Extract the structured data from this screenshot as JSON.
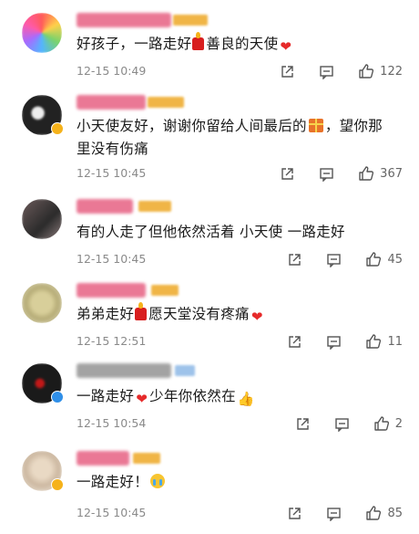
{
  "comments": [
    {
      "text": "好孩子，一路走好",
      "suffix": "善良的天使",
      "time": "12-15 10:49",
      "likes": "122"
    },
    {
      "text": "小天使友好，谢谢你留给人间最后的",
      "suffix": "，望你那",
      "text2": "里没有伤痛",
      "time": "12-15 10:45",
      "likes": "367"
    },
    {
      "text": "有的人走了但他依然活着 小天使 一路走好",
      "time": "12-15 10:45",
      "likes": "45"
    },
    {
      "text": "弟弟走好",
      "suffix": "愿天堂没有疼痛",
      "time": "12-15 12:51",
      "likes": "11"
    },
    {
      "text": "一路走好",
      "suffix": "少年你依然在",
      "time": "12-15 10:54",
      "likes": "2"
    },
    {
      "text": "一路走好！",
      "time": "12-15 10:45",
      "likes": "85"
    }
  ],
  "colors": {
    "text": "#1a1a1a",
    "meta": "#8a8a8a",
    "heart": "#e62a2a",
    "badge": "#f5b21a"
  },
  "icons": {
    "share": "share-icon",
    "comment": "comment-icon",
    "like": "thumbs-up-icon"
  }
}
